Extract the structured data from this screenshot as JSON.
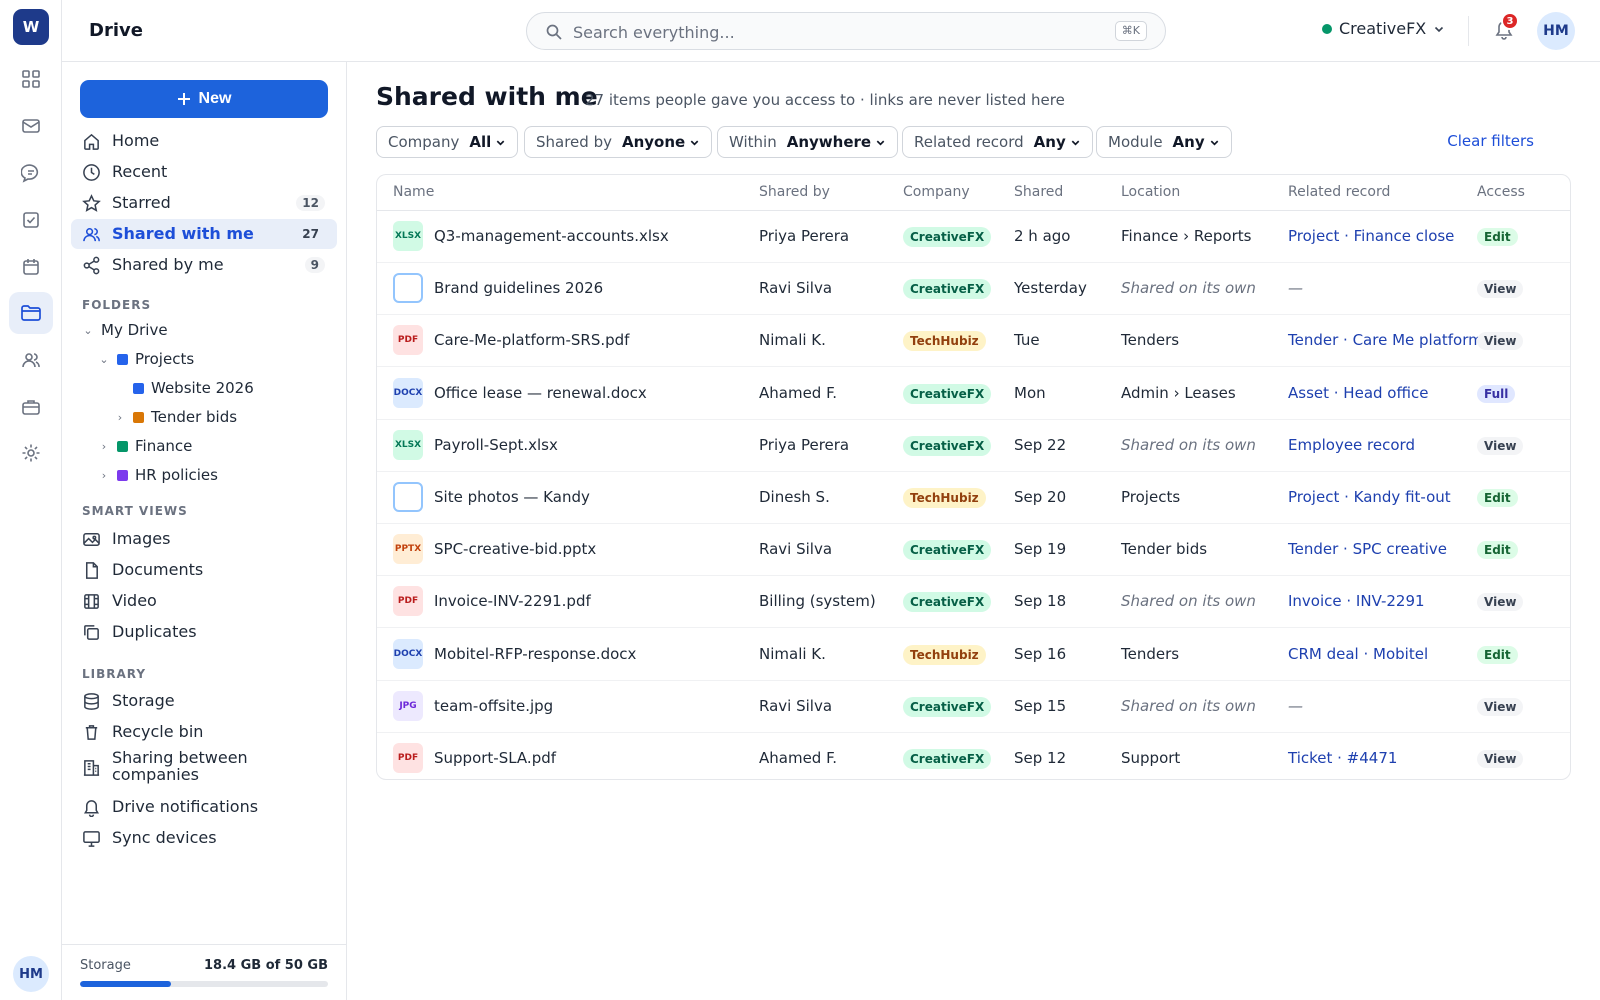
{
  "rail": {
    "logo": "W",
    "avatar": "HM",
    "active": "drive"
  },
  "header": {
    "app_title": "Drive",
    "search_placeholder": "Search everything...",
    "shortcut": "⌘K",
    "org_name": "CreativeFX",
    "org_status_color": "#059669",
    "notification_count": "3",
    "avatar": "HM"
  },
  "sidebar": {
    "new_button": "New",
    "nav": [
      {
        "label": "Home",
        "icon": "home-icon",
        "count": ""
      },
      {
        "label": "Recent",
        "icon": "clock-icon",
        "count": ""
      },
      {
        "label": "Starred",
        "icon": "star-icon",
        "count": "12"
      },
      {
        "label": "Shared with me",
        "icon": "users-icon",
        "count": "27",
        "active": true
      },
      {
        "label": "Shared by me",
        "icon": "share-icon",
        "count": "9"
      }
    ],
    "folders_title": "FOLDERS",
    "folders": {
      "my_drive": "My Drive",
      "projects": "Projects",
      "website": "Website 2026",
      "tender_bids": "Tender bids",
      "finance": "Finance",
      "hr": "HR policies",
      "colors": {
        "projects": "#2563eb",
        "website": "#2563eb",
        "tender_bids": "#d97706",
        "finance": "#059669",
        "hr": "#7c3aed"
      }
    },
    "smart_title": "SMART VIEWS",
    "smart": [
      "Images",
      "Documents",
      "Video",
      "Duplicates"
    ],
    "library_title": "LIBRARY",
    "library": [
      "Storage",
      "Recycle bin",
      "Sharing between\ncompanies",
      "Drive notifications",
      "Sync devices"
    ],
    "storage": {
      "label": "Storage",
      "value": "18.4 GB of 50 GB",
      "used_fraction": 0.368
    }
  },
  "main": {
    "title": "Shared with me",
    "subtitle": "27 items people gave you access to · links are never listed here",
    "filters": [
      {
        "label": "Company",
        "value": "All"
      },
      {
        "label": "Shared by",
        "value": "Anyone"
      },
      {
        "label": "Within",
        "value": "Anywhere"
      },
      {
        "label": "Related record",
        "value": "Any"
      },
      {
        "label": "Module",
        "value": "Any"
      }
    ],
    "clear_filters": "Clear filters",
    "columns": [
      "Name",
      "Shared by",
      "Company",
      "Shared",
      "Location",
      "Related record",
      "Access"
    ],
    "rows": [
      {
        "type": "XLSX",
        "name": "Q3-management-accounts.xlsx",
        "shared_by": "Priya Perera",
        "company": "CreativeFX",
        "shared": "2 h ago",
        "location": "Finance › Reports",
        "related": "Project · Finance close",
        "access": "Edit"
      },
      {
        "type": "",
        "name": "Brand guidelines 2026",
        "shared_by": "Ravi Silva",
        "company": "CreativeFX",
        "shared": "Yesterday",
        "location": "Shared on its own",
        "related": "—",
        "access": "View"
      },
      {
        "type": "PDF",
        "name": "Care-Me-platform-SRS.pdf",
        "shared_by": "Nimali K.",
        "company": "TechHubiz",
        "shared": "Tue",
        "location": "Tenders",
        "related": "Tender · Care Me platform",
        "access": "View"
      },
      {
        "type": "DOCX",
        "name": "Office lease — renewal.docx",
        "shared_by": "Ahamed F.",
        "company": "CreativeFX",
        "shared": "Mon",
        "location": "Admin › Leases",
        "related": "Asset · Head office",
        "access": "Full"
      },
      {
        "type": "XLSX",
        "name": "Payroll-Sept.xlsx",
        "shared_by": "Priya Perera",
        "company": "CreativeFX",
        "shared": "Sep 22",
        "location": "Shared on its own",
        "related": "Employee record",
        "access": "View"
      },
      {
        "type": "",
        "name": "Site photos — Kandy",
        "shared_by": "Dinesh S.",
        "company": "TechHubiz",
        "shared": "Sep 20",
        "location": "Projects",
        "related": "Project · Kandy fit-out",
        "access": "Edit"
      },
      {
        "type": "PPTX",
        "name": "SPC-creative-bid.pptx",
        "shared_by": "Ravi Silva",
        "company": "CreativeFX",
        "shared": "Sep 19",
        "location": "Tender bids",
        "related": "Tender · SPC creative",
        "access": "Edit"
      },
      {
        "type": "PDF",
        "name": "Invoice-INV-2291.pdf",
        "shared_by": "Billing (system)",
        "company": "CreativeFX",
        "shared": "Sep 18",
        "location": "Shared on its own",
        "related": "Invoice · INV-2291",
        "access": "View"
      },
      {
        "type": "DOCX",
        "name": "Mobitel-RFP-response.docx",
        "shared_by": "Nimali K.",
        "company": "TechHubiz",
        "shared": "Sep 16",
        "location": "Tenders",
        "related": "CRM deal · Mobitel",
        "access": "Edit"
      },
      {
        "type": "JPG",
        "name": "team-offsite.jpg",
        "shared_by": "Ravi Silva",
        "company": "CreativeFX",
        "shared": "Sep 15",
        "location": "Shared on its own",
        "related": "—",
        "access": "View"
      },
      {
        "type": "PDF",
        "name": "Support-SLA.pdf",
        "shared_by": "Ahamed F.",
        "company": "CreativeFX",
        "shared": "Sep 12",
        "location": "Support",
        "related": "Ticket · #4471",
        "access": "View"
      }
    ]
  }
}
